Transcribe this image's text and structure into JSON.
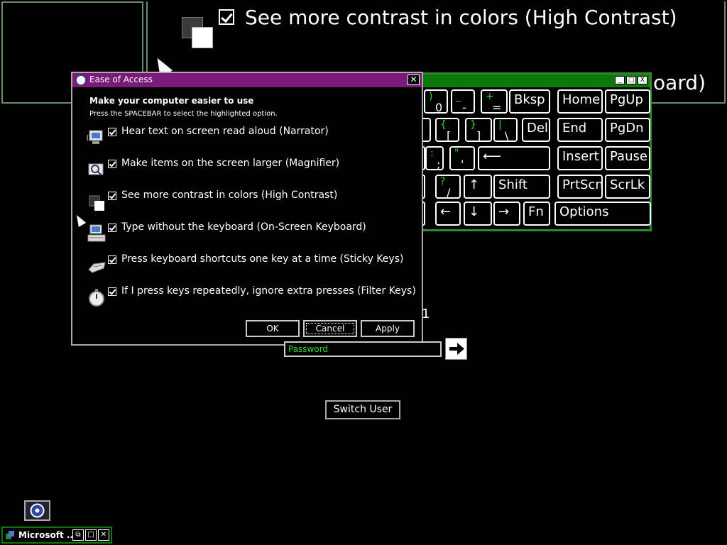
{
  "magnifier": {
    "high_contrast_text": "See more contrast in colors (High Contrast)",
    "keyboard_fragment": "oard)"
  },
  "osk": {
    "window_buttons": [
      "_",
      "□",
      "X"
    ],
    "keys": [
      {
        "top": ")",
        "bot": "0"
      },
      {
        "top": "_",
        "bot": "-"
      },
      {
        "top": "+",
        "bot": "="
      },
      {
        "label": "Bksp"
      },
      {
        "label": "Home"
      },
      {
        "label": "PgUp"
      },
      {
        "label": ""
      },
      {
        "top": "{",
        "bot": "["
      },
      {
        "top": "}",
        "bot": "]"
      },
      {
        "top": "|",
        "bot": "\\"
      },
      {
        "label": "Del"
      },
      {
        "label": "End"
      },
      {
        "label": "PgDn"
      },
      {
        "label": ""
      },
      {
        "top": ":",
        "bot": ";"
      },
      {
        "top": "\"",
        "bot": "'"
      },
      {
        "label": "⟵"
      },
      {
        "label": "Insert"
      },
      {
        "label": "Pause"
      },
      {
        "label": ""
      },
      {
        "top": "?",
        "bot": "/"
      },
      {
        "label": "↑"
      },
      {
        "label": "Shift"
      },
      {
        "label": "PrtScn"
      },
      {
        "label": "ScrLk"
      },
      {
        "label": ""
      },
      {
        "label": "←"
      },
      {
        "label": "↓"
      },
      {
        "label": "→"
      },
      {
        "label": "Fn"
      },
      {
        "label": "Options"
      }
    ]
  },
  "dialog": {
    "title": "Ease of Access",
    "close": "✕",
    "heading": "Make your computer easier to use",
    "subheading": "Press the SPACEBAR to select the highlighted option.",
    "options": [
      {
        "label": "Hear text on screen read aloud (Narrator)",
        "checked": true,
        "icon": "narrator-icon"
      },
      {
        "label": "Make items on the screen larger (Magnifier)",
        "checked": true,
        "icon": "magnifier-icon"
      },
      {
        "label": "See more contrast in colors (High Contrast)",
        "checked": true,
        "icon": "high-contrast-icon"
      },
      {
        "label": "Type without the keyboard (On-Screen Keyboard)",
        "checked": true,
        "icon": "keyboard-icon"
      },
      {
        "label": "Press keyboard shortcuts one key at a time (Sticky Keys)",
        "checked": true,
        "icon": "sticky-keys-icon"
      },
      {
        "label": "If I press keys repeatedly, ignore extra presses (Filter Keys)",
        "checked": true,
        "icon": "stopwatch-icon"
      }
    ],
    "buttons": {
      "ok": "OK",
      "cancel": "Cancel",
      "apply": "Apply"
    }
  },
  "login": {
    "password_placeholder": "Password",
    "switch_user": "Switch User",
    "stray_char": "1"
  },
  "taskbar": {
    "item_label": "Microsoft ...",
    "buttons": [
      "⧉",
      "□",
      "✕"
    ]
  }
}
